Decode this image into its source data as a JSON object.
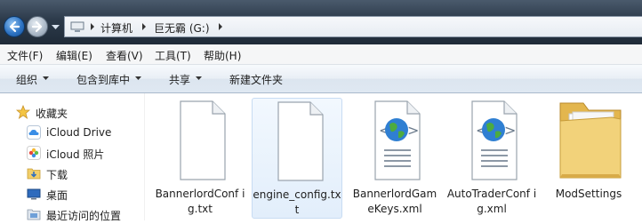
{
  "address_bar": {
    "breadcrumbs": [
      "计算机",
      "巨无霸 (G:)"
    ]
  },
  "menu_bar": {
    "items": [
      "文件(F)",
      "编辑(E)",
      "查看(V)",
      "工具(T)",
      "帮助(H)"
    ]
  },
  "command_bar": {
    "organize": "组织",
    "include_in_library": "包含到库中",
    "share": "共享",
    "new_folder": "新建文件夹"
  },
  "navigation_pane": {
    "favorites_header": "收藏夹",
    "items": [
      {
        "label": "iCloud Drive",
        "icon": "icloud-drive-icon"
      },
      {
        "label": "iCloud 照片",
        "icon": "icloud-photos-icon"
      },
      {
        "label": "下载",
        "icon": "downloads-icon"
      },
      {
        "label": "桌面",
        "icon": "desktop-icon"
      },
      {
        "label": "最近访问的位置",
        "icon": "recent-places-icon"
      }
    ]
  },
  "files": [
    {
      "name": "BannerlordConfig.txt",
      "display": "BannerlordConf ig.txt",
      "type": "txt",
      "selected": false
    },
    {
      "name": "engine_config.txt",
      "display": "engine_config.tx t",
      "type": "txt",
      "selected": true
    },
    {
      "name": "BannerlordGameKeys.xml",
      "display": "BannerlordGam eKeys.xml",
      "type": "xml",
      "selected": false
    },
    {
      "name": "AutoTraderConfig.xml",
      "display": "AutoTraderConf ig.xml",
      "type": "xml",
      "selected": false
    },
    {
      "name": "ModSettings",
      "display": "ModSettings",
      "type": "folder",
      "selected": false
    }
  ],
  "colors": {
    "selection_fill": "#e2eefb",
    "selection_border": "#c8dcf3",
    "address_bar_dark": "#1f2b38"
  }
}
